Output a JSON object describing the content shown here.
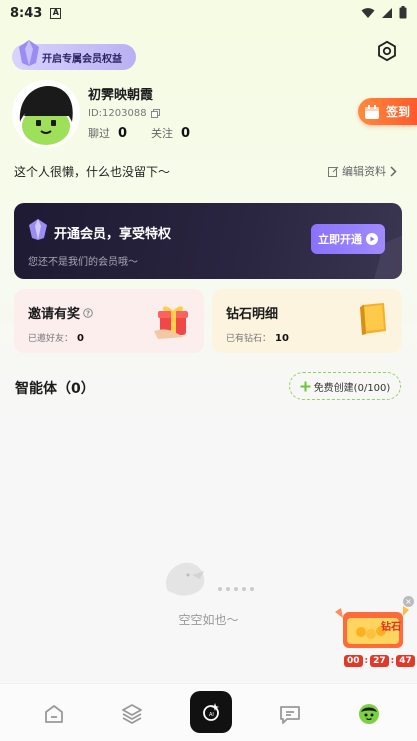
{
  "status_bar": {
    "time": "8:43",
    "notif_letter": "A"
  },
  "header": {
    "vip_badge": "开启专属会员权益"
  },
  "profile": {
    "username": "初霁映朝霞",
    "user_id": "ID:1203088",
    "stats": [
      {
        "label": "聊过",
        "value": "0"
      },
      {
        "label": "关注",
        "value": "0"
      }
    ],
    "bio": "这个人很懒，什么也没留下～",
    "edit_label": "编辑资料"
  },
  "checkin": {
    "label": "签到"
  },
  "member_card": {
    "title": "开通会员，享受特权",
    "subtitle": "您还不是我们的会员哦～",
    "button": "立即开通"
  },
  "invite": {
    "title": "邀请有奖",
    "sub_label": "已邀好友：",
    "sub_value": "0"
  },
  "diamond": {
    "title": "钻石明细",
    "sub_label": "已有钻石：",
    "sub_value": "10"
  },
  "agents": {
    "title": "智能体（0）",
    "create_label": "免费创建(0/100)",
    "empty_text": "空空如也～"
  },
  "promo": {
    "label": "钻石",
    "timer": [
      "00",
      "27",
      "47"
    ]
  },
  "colors": {
    "accent_green": "#9fe36a",
    "accent_purple": "#8a72ff",
    "checkin_orange": "#ff6a2e"
  }
}
